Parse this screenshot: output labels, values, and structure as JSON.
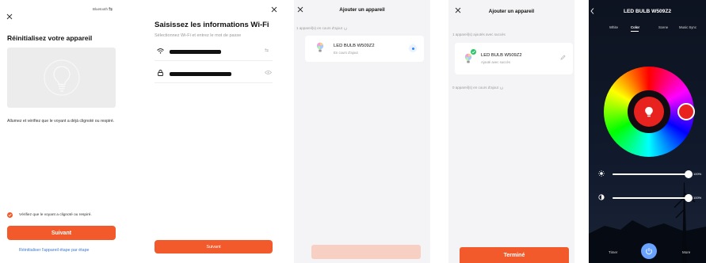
{
  "accent": "#f25a2c",
  "accent_disabled": "#f8cfc3",
  "s1": {
    "bluetooth_label": "Bluetooth",
    "title": "Réinitialisez votre appareil",
    "instruction": "Allumez et vérifiez que le voyant a déjà clignoté ou respiré.",
    "confirm_label": "Vérifiez que le voyant a clignoté ou respiré.",
    "next_label": "Suivant",
    "step_link": "Réinitialiser l'appareil étape par étape"
  },
  "s2": {
    "title": "Saisissez les informations Wi-Fi",
    "subtitle": "Sélectionnez Wi-Fi et entrez le mot de passe",
    "next_label": "Suivant"
  },
  "s3": {
    "title": "Ajouter un appareil",
    "adding_count": "1 appareil(s) en cours d'ajout",
    "device_name": "LED BULB W509Z2",
    "device_status": "En cours d'ajout"
  },
  "s4": {
    "title": "Ajouter un appareil",
    "added_count": "1 appareil(s) ajoutés avec succès",
    "device_name": "LED BULB W509Z2",
    "device_status": "Ajouté avec succès",
    "adding_count": "0 appareil(s) en cours d'ajout",
    "done_label": "Terminé"
  },
  "s5": {
    "title": "LED BULB W509Z2",
    "tabs": [
      "White",
      "Color",
      "Scene",
      "Music Sync"
    ],
    "active_tab": "Color",
    "brightness_value": "100%",
    "saturation_value": "100%",
    "brightness_level": 1.0,
    "saturation_level": 1.0,
    "bottom_left": "Timer",
    "bottom_right": "More",
    "selected_color": "#e8231f"
  }
}
